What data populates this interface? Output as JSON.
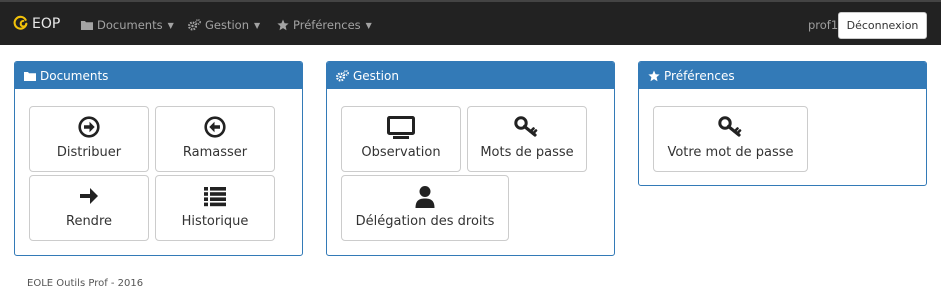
{
  "navbar": {
    "brand": "EOP",
    "menus": [
      {
        "label": "Documents",
        "icon": "folder-icon"
      },
      {
        "label": "Gestion",
        "icon": "cogs-icon"
      },
      {
        "label": "Préférences",
        "icon": "star-icon"
      }
    ],
    "user": "prof1",
    "logout_label": "Déconnexion"
  },
  "panels": {
    "documents": {
      "title": "Documents",
      "tiles": [
        {
          "label": "Distribuer",
          "icon": "circle-arrow-right-icon"
        },
        {
          "label": "Ramasser",
          "icon": "circle-arrow-left-icon"
        },
        {
          "label": "Rendre",
          "icon": "arrow-right-icon"
        },
        {
          "label": "Historique",
          "icon": "list-icon"
        }
      ]
    },
    "gestion": {
      "title": "Gestion",
      "tiles": [
        {
          "label": "Observation",
          "icon": "monitor-icon"
        },
        {
          "label": "Mots de passe",
          "icon": "key-icon"
        },
        {
          "label": "Délégation des droits",
          "icon": "user-icon"
        }
      ]
    },
    "preferences": {
      "title": "Préférences",
      "tiles": [
        {
          "label": "Votre mot de passe",
          "icon": "key-icon"
        }
      ]
    }
  },
  "footer": "EOLE Outils Prof - 2016",
  "colors": {
    "navbar_bg": "#222222",
    "panel_primary": "#337ab7",
    "brand_logo": "#f2c20a"
  }
}
